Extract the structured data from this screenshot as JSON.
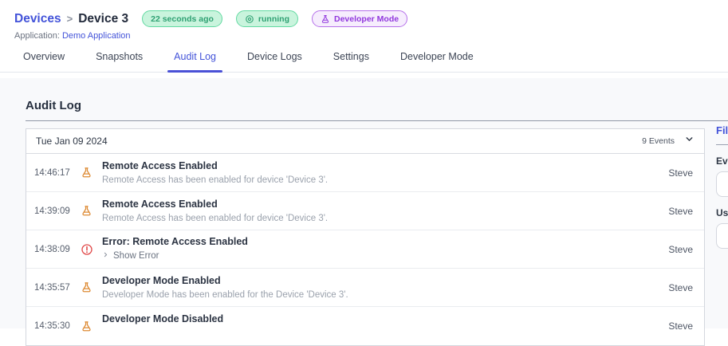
{
  "colors": {
    "accent_indigo": "#4353d9",
    "green_badge_text": "#2fa173",
    "green_badge_border": "#63d9a2",
    "green_badge_bg": "#c9f4dd",
    "purple_badge_text": "#9138dd",
    "purple_badge_border": "#b672ea",
    "purple_badge_bg": "#f6edfd",
    "flask_orange": "#dd8a33",
    "error_red": "#e14b4b"
  },
  "header": {
    "breadcrumb": {
      "parent": "Devices",
      "separator": ">",
      "current": "Device 3"
    },
    "badges": [
      {
        "label": "22 seconds ago",
        "type": "green",
        "icon": null
      },
      {
        "label": "running",
        "type": "green",
        "icon": "record"
      },
      {
        "label": "Developer Mode",
        "type": "purple",
        "icon": "flask"
      }
    ],
    "application": {
      "label": "Application:",
      "link": "Demo Application"
    }
  },
  "tabs": [
    {
      "label": "Overview",
      "active": false
    },
    {
      "label": "Snapshots",
      "active": false
    },
    {
      "label": "Audit Log",
      "active": true
    },
    {
      "label": "Device Logs",
      "active": false
    },
    {
      "label": "Settings",
      "active": false
    },
    {
      "label": "Developer Mode",
      "active": false
    }
  ],
  "main": {
    "title": "Audit Log",
    "table": {
      "date_header": "Tue Jan 09 2024",
      "events_count": "9 Events",
      "rows": [
        {
          "time": "14:46:17",
          "icon": "flask",
          "title": "Remote Access Enabled",
          "subtitle": "Remote Access has been enabled for device 'Device 3'.",
          "user": "Steve"
        },
        {
          "time": "14:39:09",
          "icon": "flask",
          "title": "Remote Access Enabled",
          "subtitle": "Remote Access has been enabled for device 'Device 3'.",
          "user": "Steve"
        },
        {
          "time": "14:38:09",
          "icon": "error",
          "title": "Error: Remote Access Enabled",
          "show_error_label": "Show Error",
          "user": "Steve"
        },
        {
          "time": "14:35:57",
          "icon": "flask",
          "title": "Developer Mode Enabled",
          "subtitle": "Developer Mode has been enabled for the Device 'Device 3'.",
          "user": "Steve"
        },
        {
          "time": "14:35:30",
          "icon": "flask",
          "title": "Developer Mode Disabled",
          "subtitle": "",
          "user": "Steve"
        }
      ]
    }
  },
  "filter_panel": {
    "title": "Filter",
    "events_label": "Events",
    "users_label": "Users"
  }
}
